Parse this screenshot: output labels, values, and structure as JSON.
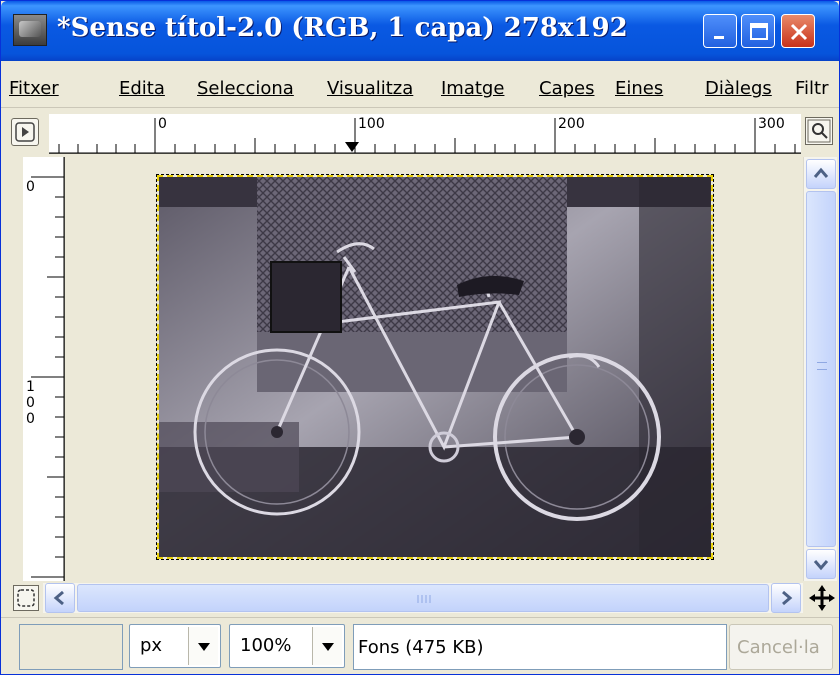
{
  "window": {
    "title": "*Sense títol-2.0 (RGB, 1 capa) 278x192"
  },
  "menu": {
    "items": [
      {
        "label": "Fitxer",
        "mnemonic_index": 0
      },
      {
        "label": "Edita",
        "mnemonic_index": 0
      },
      {
        "label": "Selecciona",
        "mnemonic_index": 0
      },
      {
        "label": "Visualitza",
        "mnemonic_index": 0
      },
      {
        "label": "Imatge",
        "mnemonic_index": 0
      },
      {
        "label": "Capes",
        "mnemonic_index": 0
      },
      {
        "label": "Eines",
        "mnemonic_index": 0
      },
      {
        "label": "Diàlegs",
        "mnemonic_index": 0
      },
      {
        "label": "Filtr",
        "mnemonic_index": -1
      }
    ]
  },
  "rulers": {
    "horizontal_labels": [
      "0",
      "100",
      "200",
      "300"
    ],
    "vertical_labels": [
      "0",
      "1\n0\n0"
    ]
  },
  "canvas": {
    "image_description": "black-and-white photo of a bicycle leaning against a wall"
  },
  "statusbar": {
    "unit": "px",
    "zoom": "100%",
    "message": "Fons (475 KB)",
    "cancel_label": "Cancel·la"
  },
  "icons": {
    "nav": "navigate-icon",
    "zoom": "zoom-icon",
    "quick_mask": "quick-mask-icon",
    "move": "move-icon"
  },
  "colors": {
    "titlebar": "#0a59e3",
    "selection_marching_ants": "#e9d10a",
    "window_bg": "#ece9d8"
  }
}
